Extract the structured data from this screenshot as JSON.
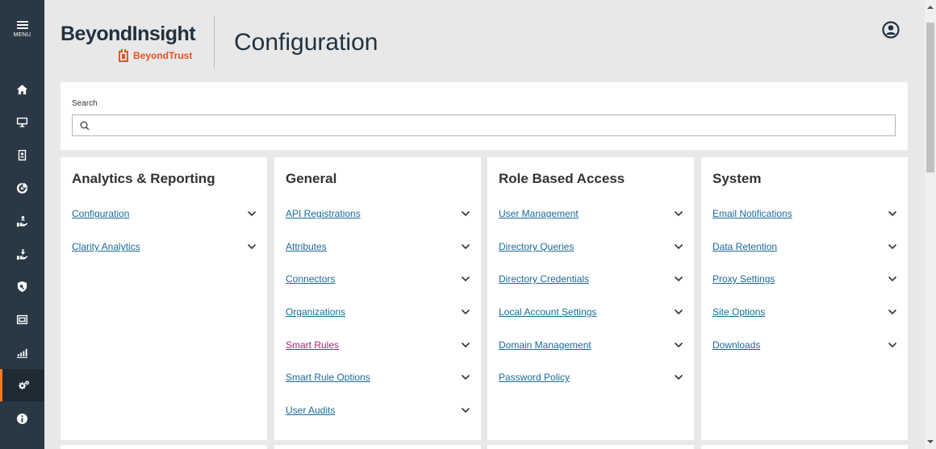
{
  "sidebar": {
    "menu_label": "MENU",
    "items": [
      {
        "icon": "home-icon"
      },
      {
        "icon": "monitor-icon"
      },
      {
        "icon": "id-badge-icon"
      },
      {
        "icon": "analytics-icon"
      },
      {
        "icon": "hand-user-icon"
      },
      {
        "icon": "hand-download-icon"
      },
      {
        "icon": "shield-key-icon"
      },
      {
        "icon": "dashboard-screen-icon"
      },
      {
        "icon": "bar-chart-icon"
      },
      {
        "icon": "gears-icon",
        "active": true
      },
      {
        "icon": "info-icon"
      }
    ],
    "active_color": "#f47a21"
  },
  "header": {
    "brand_name": "BeyondInsight",
    "brand_sub": "BeyondTrust",
    "page_title": "Configuration"
  },
  "search": {
    "label": "Search",
    "value": "",
    "placeholder": ""
  },
  "cards": [
    {
      "title": "Analytics & Reporting",
      "items": [
        {
          "label": "Configuration"
        },
        {
          "label": "Clarity Analytics"
        }
      ]
    },
    {
      "title": "General",
      "items": [
        {
          "label": "API Registrations"
        },
        {
          "label": "Attributes"
        },
        {
          "label": "Connectors"
        },
        {
          "label": "Organizations"
        },
        {
          "label": "Smart Rules",
          "visited": true
        },
        {
          "label": "Smart Rule Options"
        },
        {
          "label": "User Audits"
        }
      ]
    },
    {
      "title": "Role Based Access",
      "items": [
        {
          "label": "User Management"
        },
        {
          "label": "Directory Queries"
        },
        {
          "label": "Directory Credentials"
        },
        {
          "label": "Local Account Settings"
        },
        {
          "label": "Domain Management"
        },
        {
          "label": "Password Policy"
        }
      ]
    },
    {
      "title": "System",
      "items": [
        {
          "label": "Email Notifications"
        },
        {
          "label": "Data Retention"
        },
        {
          "label": "Proxy Settings"
        },
        {
          "label": "Site Options"
        },
        {
          "label": "Downloads"
        }
      ]
    }
  ],
  "colors": {
    "link": "#1a6a9a",
    "visited_link": "#b02270",
    "brand_orange": "#e8541e",
    "nav_bg": "#2a3744"
  }
}
